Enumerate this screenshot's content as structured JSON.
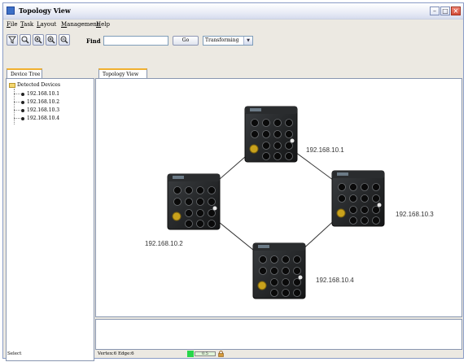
{
  "window": {
    "title": "Topology View"
  },
  "menu": [
    {
      "hot": "F",
      "rest": "ile"
    },
    {
      "hot": "T",
      "rest": "ask"
    },
    {
      "hot": "L",
      "rest": "ayout"
    },
    {
      "hot": "M",
      "rest": "anagement"
    },
    {
      "hot": "H",
      "rest": "elp"
    }
  ],
  "toolbar": {
    "find_label": "Find",
    "find_value": "",
    "go_label": "Go",
    "mode_value": "Transforming",
    "icons": [
      "filter-icon",
      "zoom-icon",
      "refresh-icon",
      "zoom-in-icon",
      "zoom-out-icon"
    ]
  },
  "left_panel": {
    "tab_label": "Device Tree",
    "root_label": "Detected Devices",
    "devices": [
      "192.168.10.1",
      "192.168.10.2",
      "192.168.10.3",
      "192.168.10.4"
    ]
  },
  "main": {
    "tab_label": "Topology View",
    "nodes": [
      {
        "id": "n1",
        "label": "192.168.10.1"
      },
      {
        "id": "n2",
        "label": "192.168.10.2"
      },
      {
        "id": "n3",
        "label": "192.168.10.3"
      },
      {
        "id": "n4",
        "label": "192.168.10.4"
      }
    ],
    "edges": [
      [
        "n1",
        "n3"
      ],
      [
        "n1",
        "n2"
      ],
      [
        "n2",
        "n4"
      ],
      [
        "n4",
        "n3"
      ]
    ]
  },
  "status": {
    "mode": "Select",
    "counts": "Vertex:6 Edge:6",
    "indicator_color": "#27d64a",
    "progress_text": "0.5"
  }
}
